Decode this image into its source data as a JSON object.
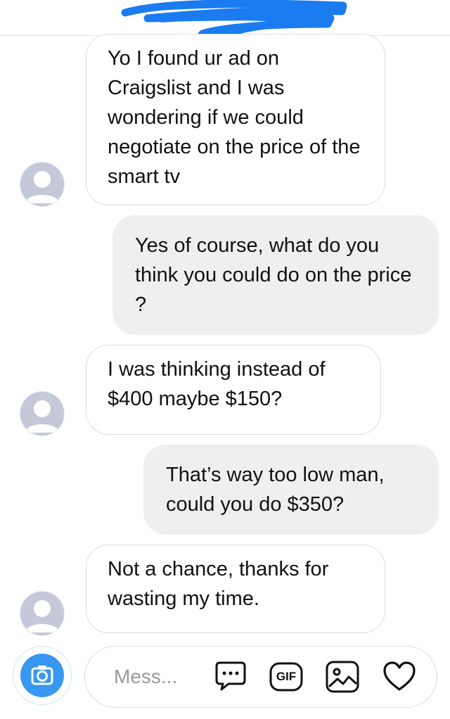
{
  "messages": [
    {
      "direction": "incoming",
      "text": "Yo I found ur ad on Craigslist and I was wondering if we could negotiate on the price of the smart tv"
    },
    {
      "direction": "outgoing",
      "text": "Yes of course, what do you think you could do on the price ?"
    },
    {
      "direction": "incoming",
      "text": "I was thinking instead of $400 maybe $150?"
    },
    {
      "direction": "outgoing",
      "text": "That’s way too low man, could you do $350?"
    },
    {
      "direction": "incoming",
      "text": "Not a chance, thanks for wasting my time."
    }
  ],
  "composer": {
    "placeholder": "Mess...",
    "gif_label": "GIF",
    "icons": [
      "camera-icon",
      "chat-bubble-icon",
      "gif-icon",
      "gallery-icon",
      "heart-icon"
    ]
  },
  "colors": {
    "accent": "#3897f0",
    "outgoing_bubble": "#efefef",
    "incoming_border": "#dddddd",
    "scribble": "#1a7cf0"
  }
}
